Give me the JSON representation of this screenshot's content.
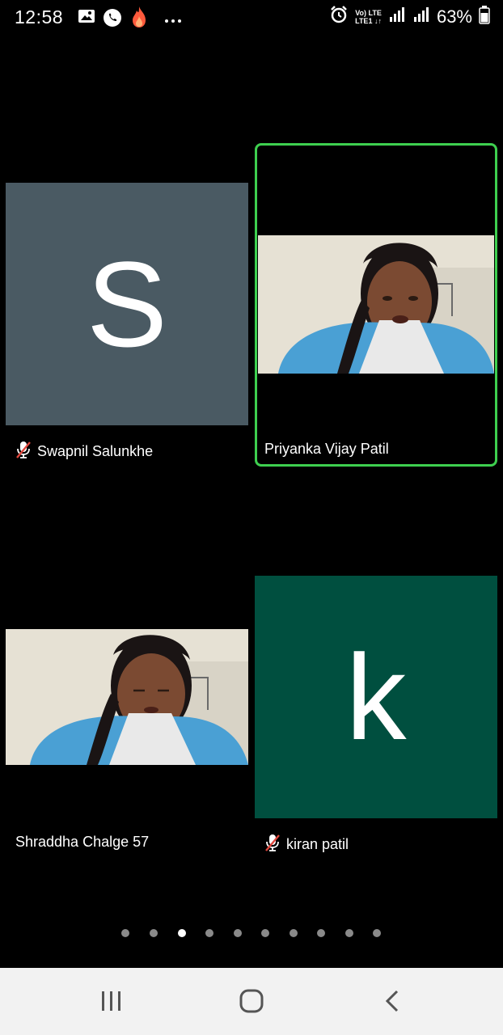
{
  "status_bar": {
    "time": "12:58",
    "network_line1": "Vo) LTE",
    "network_line2": "LTE1 ↓↑",
    "battery_percent": "63%",
    "icons": [
      "image-icon",
      "whatsapp-icon",
      "fire-icon",
      "more-dots-icon",
      "alarm-icon",
      "signal-icon",
      "signal-icon",
      "battery-icon"
    ]
  },
  "participants": [
    {
      "name": "Swapnil Salunkhe",
      "avatar_letter": "S",
      "avatar_color": "#4a5a63",
      "muted": true,
      "active_speaker": false,
      "video": false
    },
    {
      "name": "Priyanka Vijay Patil",
      "muted": false,
      "active_speaker": true,
      "video": true
    },
    {
      "name": "Shraddha Chalge 57",
      "muted": false,
      "active_speaker": false,
      "video": true
    },
    {
      "name": "kiran patil",
      "avatar_letter": "k",
      "avatar_color": "#004f3f",
      "muted": true,
      "active_speaker": false,
      "video": false
    }
  ],
  "pagination": {
    "total_pages": 10,
    "current_page": 3
  },
  "colors": {
    "active_speaker_border": "#3ecf4f",
    "muted_icon": "#e0463c"
  },
  "nav_bar": {
    "icons": [
      "recent-apps-icon",
      "home-icon",
      "back-icon"
    ]
  }
}
